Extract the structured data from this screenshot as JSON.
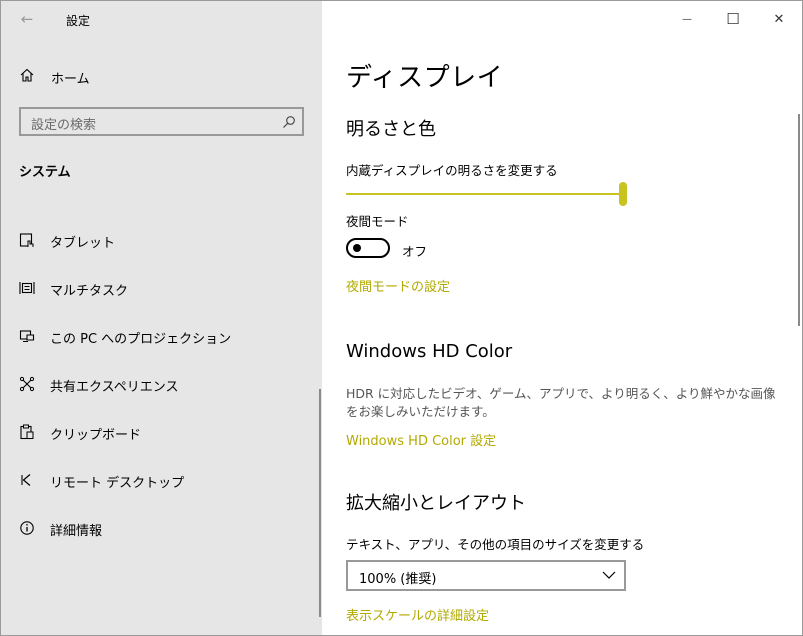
{
  "window": {
    "title": "設定",
    "controls": {
      "minimize": "—",
      "maximize": "☐",
      "close": "✕"
    }
  },
  "sidebar": {
    "back_glyph": "←",
    "home_label": "ホーム",
    "search_placeholder": "設定の検索",
    "section_title": "システム",
    "items": [
      {
        "label": "タブレット",
        "icon": "tablet-icon"
      },
      {
        "label": "マルチタスク",
        "icon": "multitask-icon"
      },
      {
        "label": "この PC へのプロジェクション",
        "icon": "projection-icon"
      },
      {
        "label": "共有エクスペリエンス",
        "icon": "shared-experience-icon"
      },
      {
        "label": "クリップボード",
        "icon": "clipboard-icon"
      },
      {
        "label": "リモート デスクトップ",
        "icon": "remote-desktop-icon"
      },
      {
        "label": "詳細情報",
        "icon": "info-icon"
      }
    ]
  },
  "content": {
    "page_title": "ディスプレイ",
    "brightness": {
      "heading": "明るさと色",
      "slider_label": "内蔵ディスプレイの明るさを変更する",
      "slider_value": 100
    },
    "night_light": {
      "label": "夜間モード",
      "state": "オフ",
      "settings_link": "夜間モードの設定"
    },
    "hd_color": {
      "heading": "Windows HD Color",
      "description": "HDR に対応したビデオ、ゲーム、アプリで、より明るく、より鮮やかな画像をお楽しみいただけます。",
      "settings_link": "Windows HD Color 設定"
    },
    "scale": {
      "heading": "拡大縮小とレイアウト",
      "size_label": "テキスト、アプリ、その他の項目のサイズを変更する",
      "selected": "100% (推奨)",
      "advanced_link": "表示スケールの詳細設定"
    }
  },
  "colors": {
    "accent": "#c7c421",
    "link": "#b2aa00",
    "sidebar_bg": "#e6e6e6"
  }
}
